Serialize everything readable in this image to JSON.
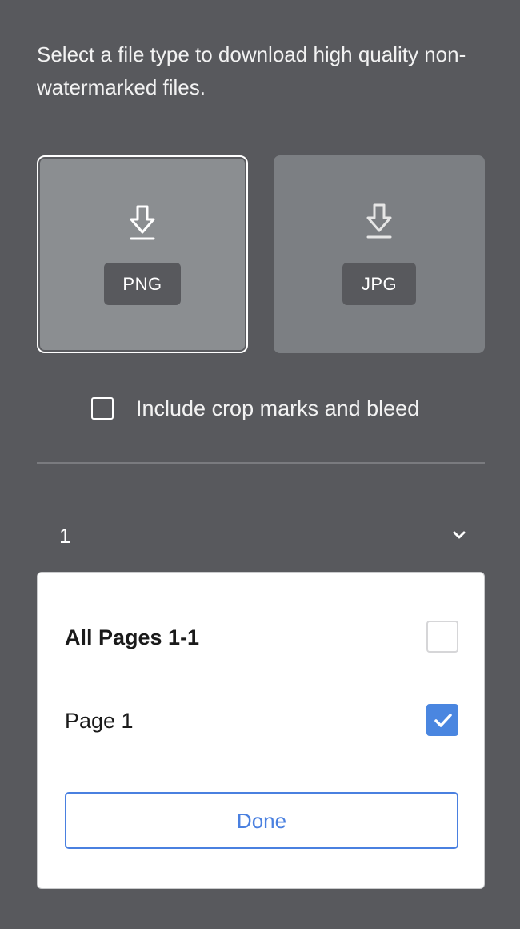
{
  "intro": {
    "text": "Select a file type to download high quality non-watermarked files."
  },
  "file_types": [
    {
      "label": "PNG",
      "icon": "download-icon",
      "selected": true
    },
    {
      "label": "JPG",
      "icon": "download-icon",
      "selected": false
    }
  ],
  "crop_option": {
    "label": "Include crop marks and bleed",
    "checked": false
  },
  "page_select": {
    "value": "1",
    "icon": "chevron-down-icon"
  },
  "page_options": [
    {
      "label": "All Pages 1-1",
      "checked": false
    },
    {
      "label": "Page 1",
      "checked": true
    }
  ],
  "done_button": {
    "label": "Done"
  },
  "colors": {
    "background": "#58595d",
    "accent": "#4a86e0",
    "card_selected": "#8b8e91",
    "card_unselected": "#7c7f83"
  }
}
